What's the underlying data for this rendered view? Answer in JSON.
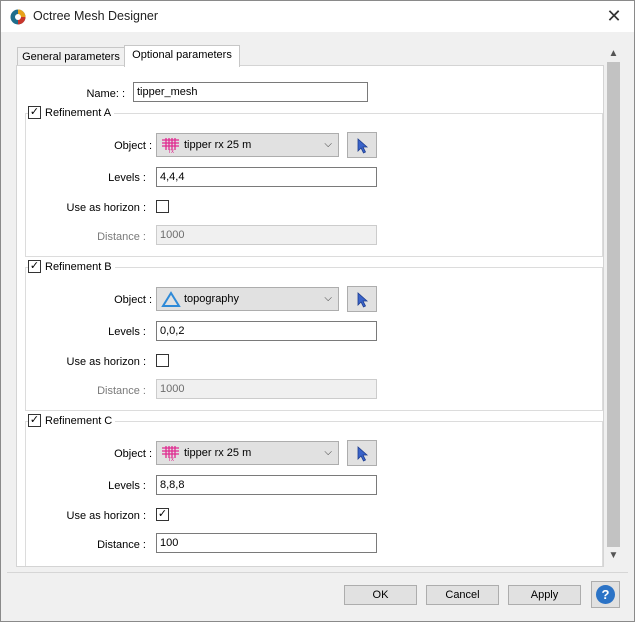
{
  "window": {
    "title": "Octree Mesh Designer"
  },
  "tabs": [
    {
      "label": "General parameters"
    },
    {
      "label": "Optional parameters"
    }
  ],
  "name_row": {
    "label": "Name: :",
    "value": "tipper_mesh"
  },
  "refinements": [
    {
      "title": "Refinement A",
      "enabled": true,
      "object_label": "Object :",
      "object_value": "tipper rx 25 m",
      "object_icon": "tipper-rx-icon",
      "levels_label": "Levels :",
      "levels_value": "4,4,4",
      "horizon_label": "Use as horizon :",
      "horizon_checked": false,
      "distance_label": "Distance :",
      "distance_value": "1000",
      "distance_enabled": false
    },
    {
      "title": "Refinement B",
      "enabled": true,
      "object_label": "Object :",
      "object_value": "topography",
      "object_icon": "topography-icon",
      "levels_label": "Levels :",
      "levels_value": "0,0,2",
      "horizon_label": "Use as horizon :",
      "horizon_checked": false,
      "distance_label": "Distance :",
      "distance_value": "1000",
      "distance_enabled": false
    },
    {
      "title": "Refinement C",
      "enabled": true,
      "object_label": "Object :",
      "object_value": "tipper rx 25 m",
      "object_icon": "tipper-rx-icon",
      "levels_label": "Levels :",
      "levels_value": "8,8,8",
      "horizon_label": "Use as horizon :",
      "horizon_checked": true,
      "distance_label": "Distance :",
      "distance_value": "100",
      "distance_enabled": true
    }
  ],
  "buttons": {
    "ok": "OK",
    "cancel": "Cancel",
    "apply": "Apply",
    "help": "?"
  },
  "colors": {
    "accent": "#2b73c6",
    "tipper_icon": "#e0298f",
    "topography_icon": "#2e8ad8"
  }
}
